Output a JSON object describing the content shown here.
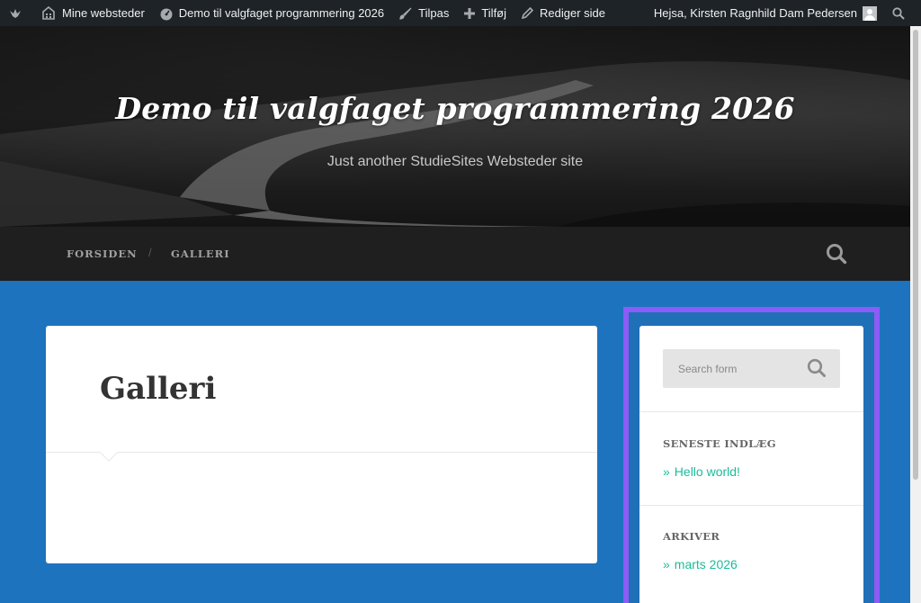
{
  "adminbar": {
    "my_sites": "Mine websteder",
    "site_name": "Demo til valgfaget programmering 2026",
    "customize": "Tilpas",
    "new": "Tilføj",
    "edit": "Rediger side",
    "greeting": "Hejsa, Kirsten Ragnhild Dam Pedersen"
  },
  "header": {
    "title": "Demo til valgfaget programmering 2026",
    "description": "Just another StudieSites Websteder site"
  },
  "nav": {
    "items": [
      "FORSIDEN",
      "GALLERI"
    ],
    "separator": "/"
  },
  "post": {
    "title": "Galleri"
  },
  "sidebar": {
    "search_placeholder": "Search form",
    "recent_title": "SENESTE INDLÆG",
    "recent_posts": [
      "Hello world!"
    ],
    "archive_title": "ARKIVER",
    "archives": [
      "marts 2026"
    ],
    "bullet": "»"
  },
  "colors": {
    "accent": "#1abc9c",
    "background": "#1e73be",
    "highlight": "#8b5cf6",
    "adminbar": "#1d2327"
  }
}
